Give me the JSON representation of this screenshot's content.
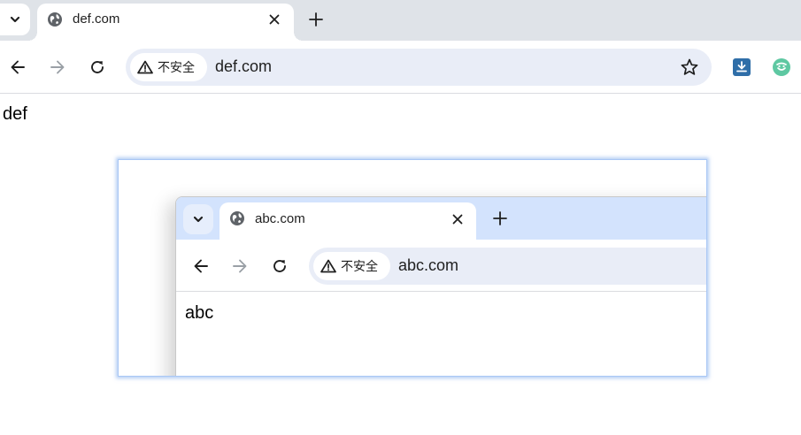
{
  "browser": {
    "tab": {
      "title": "def.com",
      "favicon": "globe-icon"
    },
    "toolbar": {
      "back_icon": "arrow-left-icon",
      "forward_icon": "arrow-right-icon",
      "reload_icon": "reload-icon",
      "security_chip": "不安全",
      "url": "def.com",
      "bookmark_icon": "star-icon",
      "extensions": [
        "download-extension-icon",
        "green-extension-icon"
      ]
    },
    "page_text": "def"
  },
  "screenshot": {
    "tab": {
      "title": "abc.com",
      "favicon": "globe-icon"
    },
    "toolbar": {
      "security_chip": "不安全",
      "url": "abc.com"
    },
    "page_text": "abc"
  },
  "colors": {
    "tabstrip_bg": "#dfe3e8",
    "omnibox_bg": "#e9edf7",
    "inner_tabstrip_bg": "#d3e3fd",
    "download_ext": "#2f6ea8",
    "green_ext": "#5ec8a2"
  }
}
